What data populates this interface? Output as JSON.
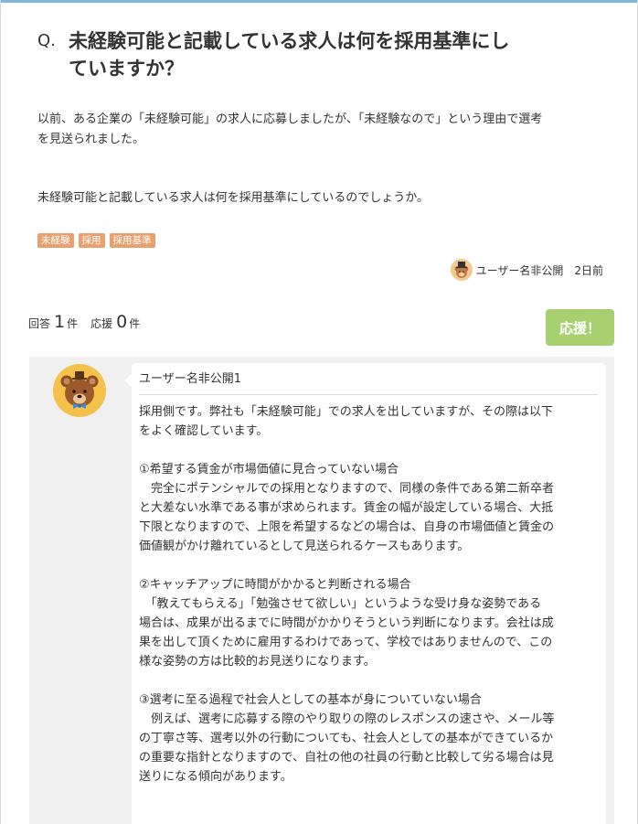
{
  "question": {
    "mark": "Q.",
    "title_line1": "未経験可能と記載している求人は何を採用基準にし",
    "title_line2": "ていますか？",
    "body_line1": "以前、ある企業の「未経験可能」の求人に応募しましたが、「未経験なので」という理由で選考",
    "body_line2": "を見送られました。",
    "body_line3": "未経験可能と記載している求人は何を採用基準にしているのでしょうか。",
    "tags": [
      "未経験",
      "採用",
      "採用基準"
    ],
    "asker_name": "ユーザー名非公開",
    "posted": "2日前"
  },
  "stats": {
    "answer_label": "回答",
    "answer_count": "1",
    "answer_unit": "件",
    "cheer_label": "応援",
    "cheer_count": "0",
    "cheer_unit": "件",
    "cheer_button": "応援！"
  },
  "answer": {
    "author": "ユーザー名非公開1",
    "lines": [
      "採用側です。弊社も「未経験可能」での求人を出していますが、その際は以下",
      "をよく確認しています。",
      "",
      "①希望する賃金が市場価値に見合っていない場合",
      "　完全にポテンシャルでの採用となりますので、同様の条件である第二新卒者",
      "と大差ない水準である事が求められます。賃金の幅が設定している場合、大抵",
      "下限となりますので、上限を希望するなどの場合は、自身の市場価値と賃金の",
      "価値観がかけ離れているとして見送られるケースもあります。",
      "",
      "②キャッチアップに時間がかかると判断される場合",
      "　「教えてもらえる」「勉強させて欲しい」というような受け身な姿勢である",
      "場合は、成果が出るまでに時間がかかりそうという判断になります。会社は成",
      "果を出して頂くために雇用するわけであって、学校ではありませんので、この",
      "様な姿勢の方は比較的お見送りになります。",
      "",
      "③選考に至る過程で社会人としての基本が身についていない場合",
      "　例えば、選考に応募する際のやり取りの際のレスポンスの速さや、メール等",
      "の丁寧さ等、選考以外の行動についても、社会人としての基本ができているか",
      "の重要な指針となりますので、自社の他の社員の行動と比較して劣る場合は見",
      "送りになる傾向があります。"
    ]
  },
  "colors": {
    "accent_top": "#7fb7df",
    "tag": "#e8a06f",
    "cheer_button": "#a7d070",
    "answer_bg": "#f0f0f0"
  },
  "icons": {
    "asker_avatar": "bear-with-hat-icon",
    "answerer_avatar": "bear-with-bowtie-icon"
  }
}
